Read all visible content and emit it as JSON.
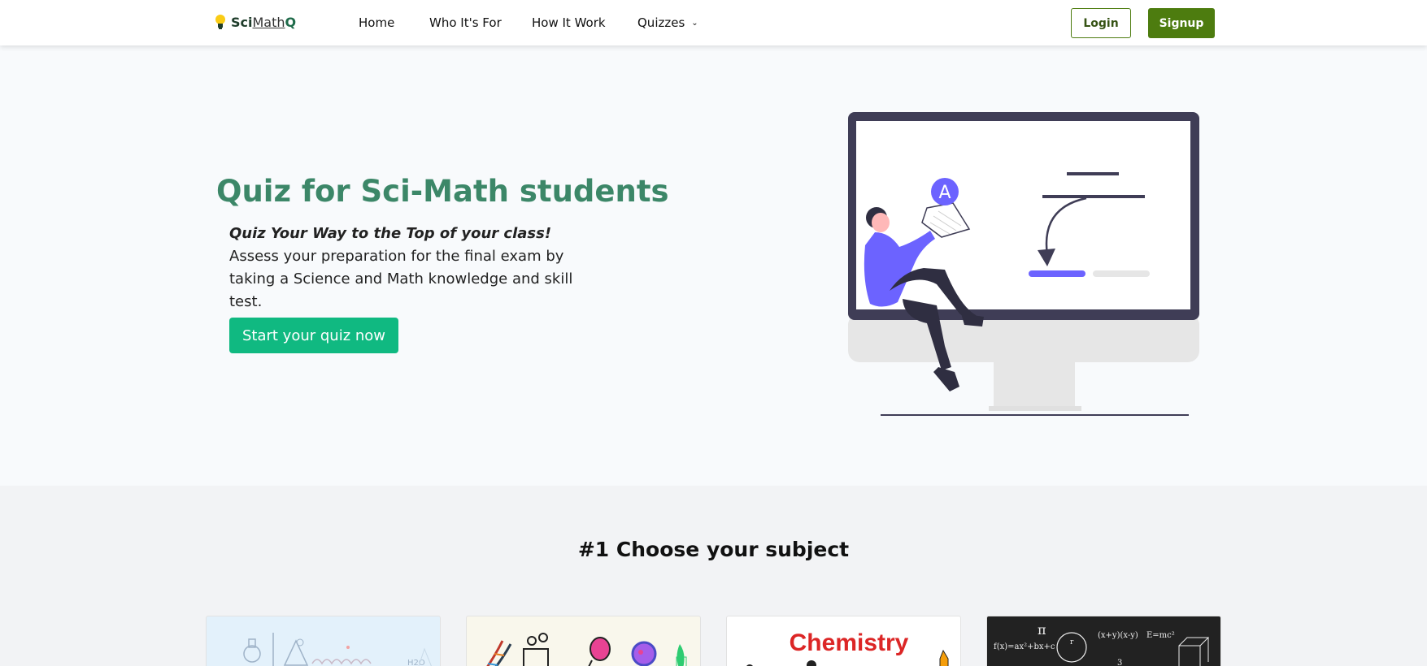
{
  "nav": {
    "logo": {
      "part1": "Sci",
      "part2": "Math",
      "part3": "Q"
    },
    "links": [
      "Home",
      "Who It's For",
      "How It Work",
      "Quizzes"
    ],
    "login": "Login",
    "signup": "Signup"
  },
  "hero": {
    "title": "Quiz for Sci-Math students",
    "tagline": "Quiz Your Way to the Top of your class!",
    "description": " Assess your preparation for the final exam by taking a Science and Math knowledge and skill test.",
    "cta": "Start your quiz now",
    "illustration_letter": "A"
  },
  "subjects": {
    "title": "#1 Choose your subject",
    "cards": [
      {
        "name": "physics-card",
        "text": "H2O"
      },
      {
        "name": "biology-card"
      },
      {
        "name": "chemistry-card",
        "text": "Chemistry"
      },
      {
        "name": "math-card",
        "formula1": "f(x)=ax²+bx+c",
        "formula2": "E=mc²",
        "formula3": "(x+y)(x-y)"
      }
    ]
  },
  "colors": {
    "brand_green": "#4d7c0f",
    "title_green": "#3c8768",
    "cta_green": "#10b981",
    "accent_purple": "#6c63ff",
    "dark": "#3f3d56"
  }
}
